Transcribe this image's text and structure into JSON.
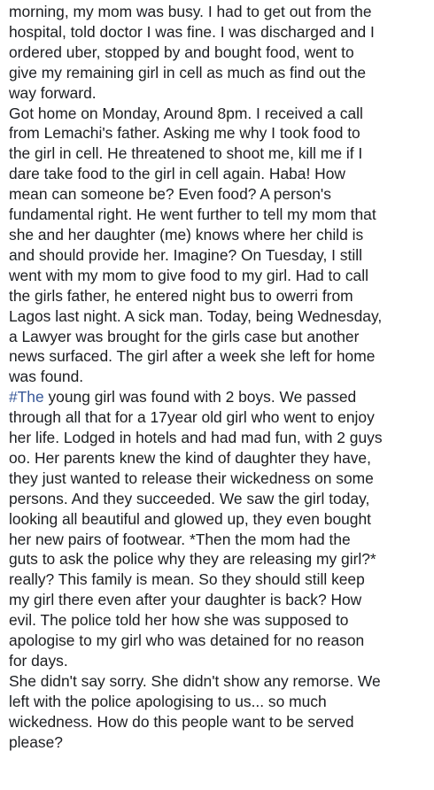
{
  "post": {
    "lines": [
      "morning, my mom was busy. I had to get out from the",
      "hospital, told doctor I was fine. I was discharged and I",
      "ordered uber, stopped by and bought food, went to",
      "give my remaining girl in cell as much as find out the",
      "way forward.",
      "Got home on Monday, Around 8pm. I received a call",
      "from Lemachi's father. Asking me why I took food to",
      "the girl in cell. He threatened to shoot me, kill me if I",
      "dare take food to the girl in cell again. Haba! How",
      "mean can someone be? Even food? A person's",
      "fundamental right. He went further to tell my mom that",
      "she and her daughter (me) knows where her child is",
      "and should provide her. Imagine? On Tuesday, I still",
      "went with my mom to give food to my girl. Had to call",
      "the girls father, he entered night bus to owerri from",
      "Lagos last night. A sick man. Today, being Wednesday,",
      "a Lawyer was brought for the girls case but another",
      "news surfaced. The girl after a week she left for home",
      "was found.",
      "young girl was found with 2 boys. We passed",
      "through all that for a 17year old girl who went to enjoy",
      "her life. Lodged in hotels and had mad fun, with 2 guys",
      "oo. Her parents knew the kind of daughter they have,",
      "they just wanted to release their wickedness on some",
      "persons. And they succeeded. We saw the girl today,",
      "looking all beautiful and glowed up, they even bought",
      "her new pairs of footwear. *Then the mom had the",
      "guts to ask the police why they are releasing my girl?*",
      "really? This family is mean. So they should still keep",
      "my girl there even after your daughter is back? How",
      "evil. The police told her how she was supposed to",
      "apologise to my girl who was detained for no reason",
      "for days.",
      "She didn't say sorry. She didn't show any remorse. We",
      "left with the police apologising to us... so much",
      "wickedness. How do this people want to be served",
      "please?"
    ],
    "hashtag": "#The",
    "hashtag_color": "#385898",
    "text_color": "#1c1e21"
  }
}
